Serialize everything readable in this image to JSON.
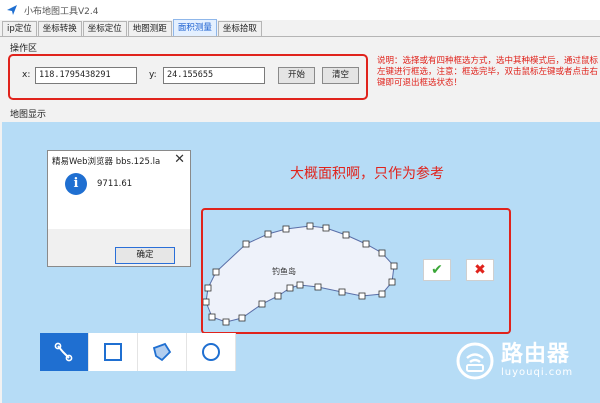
{
  "window": {
    "title": "小布地图工具V2.4"
  },
  "tabs": [
    {
      "label": "ip定位"
    },
    {
      "label": "坐标转换"
    },
    {
      "label": "坐标定位"
    },
    {
      "label": "地图测距"
    },
    {
      "label": "面积测量",
      "active": true
    },
    {
      "label": "坐标拾取"
    }
  ],
  "ops": {
    "group_label": "操作区",
    "x_label": "x:",
    "x_value": "118.1795438291",
    "y_label": "y:",
    "y_value": "24.155655",
    "start_label": "开始",
    "clear_label": "清空"
  },
  "note": "说明：选择或有四种框选方式，选中其种模式后，通过鼠标左键进行框选，注意：框选完毕，双击鼠标左键或者点击右键即可退出框选状态！",
  "map": {
    "group_label": "地图显示"
  },
  "dialog": {
    "title": "精易Web浏览器 bbs.125.la",
    "close": "✕",
    "icon": "i",
    "value": "9711.61",
    "ok_label": "确定"
  },
  "caption": "大概面积啊，只作为参考",
  "polygon": {
    "label": "钓鱼岛",
    "fill": "#eef2fa",
    "stroke": "#5a6fa8"
  },
  "actions": {
    "confirm": "✔",
    "cancel": "✖"
  },
  "draw_tools": [
    {
      "name": "polyline-tool",
      "icon": "polyline-icon",
      "active": true
    },
    {
      "name": "rectangle-tool",
      "icon": "rectangle-icon",
      "active": false
    },
    {
      "name": "polygon-tool",
      "icon": "polygon-icon",
      "active": false
    },
    {
      "name": "circle-tool",
      "icon": "circle-icon",
      "active": false
    }
  ],
  "watermark": {
    "cn": "路由器",
    "en": "luyouqi.com"
  },
  "colors": {
    "accent": "#1f6fd1",
    "highlight": "#e0231c",
    "map_water": "#b6dcf6"
  }
}
